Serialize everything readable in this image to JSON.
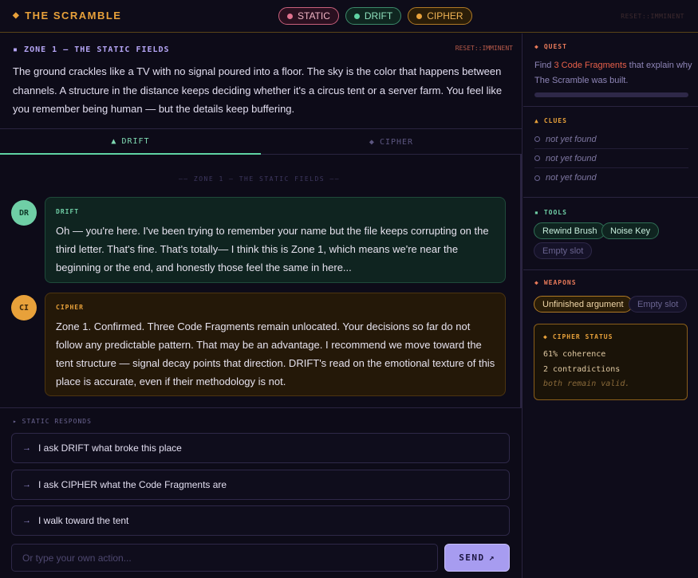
{
  "header": {
    "brand": "THE SCRAMBLE",
    "chips": [
      "STATIC",
      "DRIFT",
      "CIPHER"
    ],
    "reset": "RESET::IMMINENT"
  },
  "intro": {
    "zone": "ZONE 1 — THE STATIC FIELDS",
    "reset": "RESET::IMMINENT",
    "text": "The ground crackles like a TV with no signal poured into a floor. The sky is the color that happens between channels. A structure in the distance keeps deciding whether it's a circus tent or a server farm. You feel like you remember being human — but the details keep buffering."
  },
  "tabs": {
    "drift": "DRIFT",
    "cipher": "CIPHER"
  },
  "chat": {
    "divider": "—— ZONE 1 — THE STATIC FIELDS ——",
    "messages": [
      {
        "avatar": "DR",
        "who": "DRIFT",
        "text": "Oh — you're here. I've been trying to remember your name but the file keeps corrupting on the third letter. That's fine. That's totally— I think this is Zone 1, which means we're near the beginning or the end, and honestly those feel the same in here..."
      },
      {
        "avatar": "CI",
        "who": "CIPHER",
        "text": "Zone 1. Confirmed. Three Code Fragments remain unlocated. Your decisions so far do not follow any predictable pattern. That may be an advantage. I recommend we move toward the tent structure — signal decay points that direction. DRIFT's read on the emotional texture of this place is accurate, even if their methodology is not."
      }
    ]
  },
  "responds": {
    "label": "STATIC RESPONDS",
    "options": [
      "I ask DRIFT what broke this place",
      "I ask CIPHER what the Code Fragments are",
      "I walk toward the tent"
    ],
    "input_placeholder": "Or type your own action...",
    "send": "SEND"
  },
  "sidebar": {
    "quest": {
      "title": "QUEST",
      "text_before": "Find ",
      "highlight": "3 Code Fragments",
      "text_after": " that explain why The Scramble was built.",
      "progress": 0
    },
    "clues": {
      "title": "CLUES",
      "items": [
        "not yet found",
        "not yet found",
        "not yet found"
      ]
    },
    "tools": {
      "title": "TOOLS",
      "items": [
        "Rewind Brush",
        "Noise Key",
        "Empty slot"
      ]
    },
    "weapons": {
      "title": "WEAPONS",
      "items": [
        "Unfinished argument",
        "Empty slot"
      ]
    },
    "status": {
      "title": "CIPHER STATUS",
      "lines": [
        "61% coherence",
        "2 contradictions",
        "both remain valid."
      ]
    }
  },
  "colors": {
    "accent": "#e8a13a",
    "drift": "#5fd3a3",
    "static": "#e0728f",
    "cipher": "#e8a13a",
    "send": "#a79cf0"
  }
}
